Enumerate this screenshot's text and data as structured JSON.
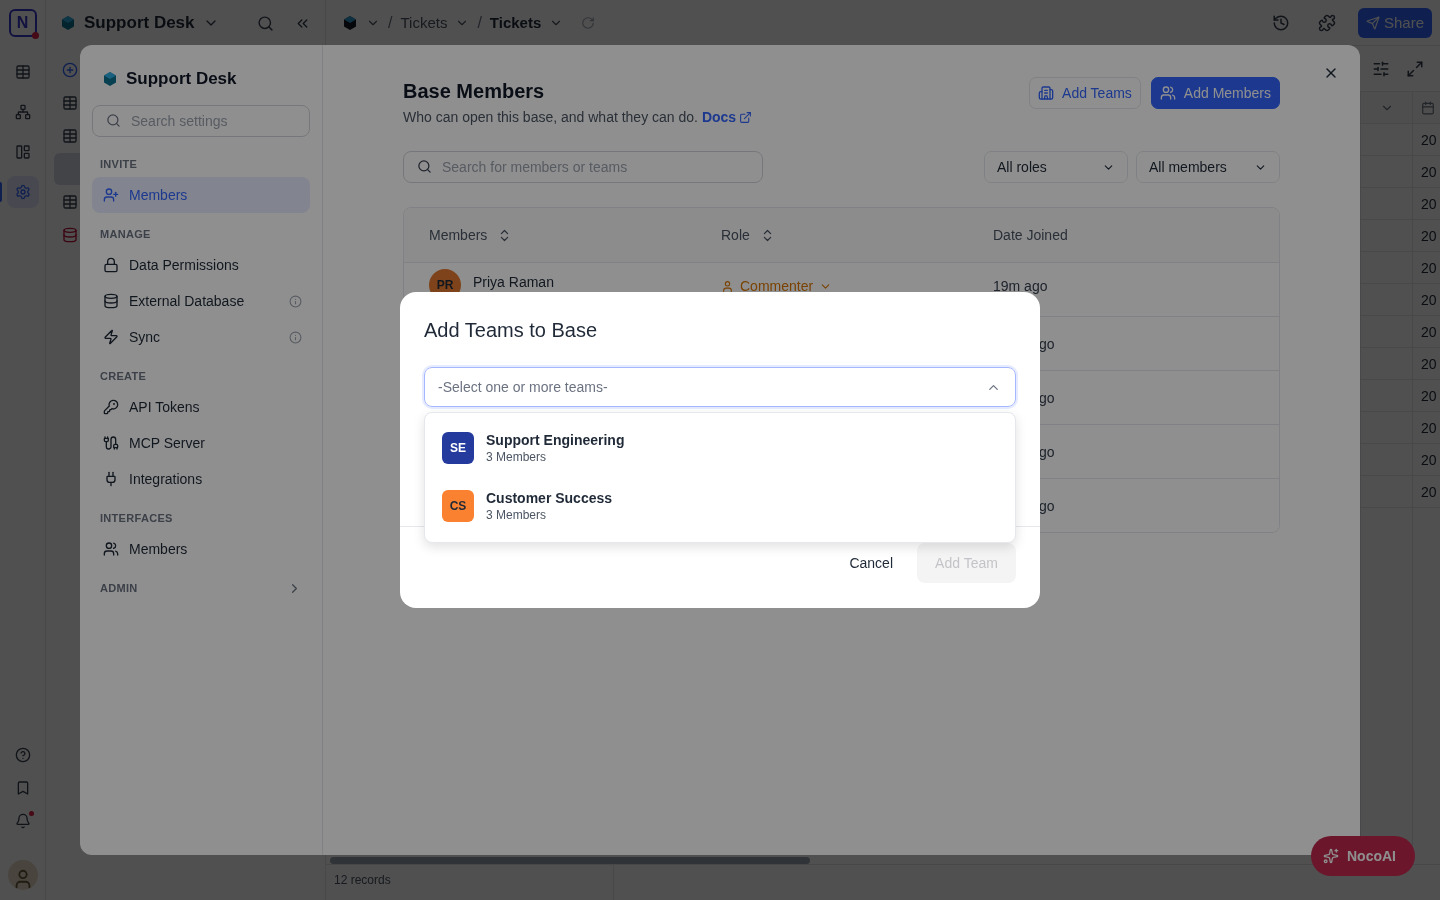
{
  "rail": {
    "logo": "N",
    "items": [
      {
        "selected": false
      },
      {
        "selected": false
      },
      {
        "selected": false
      },
      {
        "selected": true
      }
    ],
    "unread": true
  },
  "sidebar": {
    "title": "Support Desk",
    "rows": [
      {
        "kind": "add",
        "selected": false
      },
      {
        "kind": "table",
        "selected": false
      },
      {
        "kind": "table",
        "selected": false
      },
      {
        "kind": "blank",
        "selected": true
      },
      {
        "kind": "table",
        "selected": false
      },
      {
        "kind": "database",
        "selected": false
      }
    ]
  },
  "topbar": {
    "breadcrumb": [
      {
        "separator": "/",
        "label": "Tickets"
      },
      {
        "separator": "/",
        "label": "Tickets"
      }
    ],
    "share": "Share"
  },
  "grid": {
    "cells": [
      "20",
      "20",
      "20",
      "20",
      "20",
      "20",
      "20",
      "20",
      "20",
      "20",
      "20",
      "20"
    ]
  },
  "footer": {
    "records": "12 records"
  },
  "settings": {
    "title": "Support Desk",
    "search_placeholder": "Search settings",
    "sections": [
      {
        "heading": "INVITE",
        "items": [
          {
            "label": "Members",
            "selected": true,
            "info": false
          }
        ]
      },
      {
        "heading": "MANAGE",
        "items": [
          {
            "label": "Data Permissions",
            "selected": false,
            "info": false
          },
          {
            "label": "External Database",
            "selected": false,
            "info": true
          },
          {
            "label": "Sync",
            "selected": false,
            "info": true
          }
        ]
      },
      {
        "heading": "CREATE",
        "items": [
          {
            "label": "API Tokens",
            "selected": false,
            "info": false
          },
          {
            "label": "MCP Server",
            "selected": false,
            "info": false
          },
          {
            "label": "Integrations",
            "selected": false,
            "info": false
          }
        ]
      },
      {
        "heading": "INTERFACES",
        "items": [
          {
            "label": "Members",
            "selected": false,
            "info": false
          }
        ]
      },
      {
        "heading": "ADMIN",
        "expanded": false
      }
    ]
  },
  "members_page": {
    "title": "Base Members",
    "subtitle": "Who can open this base, and what they can do.",
    "docs_link": "Docs",
    "add_teams": "Add Teams",
    "add_members": "Add Members",
    "search_placeholder": "Search for members or teams",
    "filters": [
      "All roles",
      "All members"
    ],
    "columns": [
      "Members",
      "Role",
      "Date Joined"
    ],
    "rows": [
      {
        "kind": "member",
        "initials": "PR",
        "name": "Priya Raman",
        "role": "Commenter",
        "date": "19m ago"
      },
      {
        "kind": "covered",
        "date": "go"
      },
      {
        "kind": "covered",
        "date": "go"
      },
      {
        "kind": "covered",
        "date": "go"
      },
      {
        "kind": "covered",
        "date": "go"
      }
    ]
  },
  "dialog": {
    "title": "Add Teams to Base",
    "placeholder": "-Select one or more teams-",
    "expanded": true,
    "options": [
      {
        "initials": "SE",
        "name": "Support Engineering",
        "count": "3 Members",
        "color": "#243a9c"
      },
      {
        "initials": "CS",
        "name": "Customer Success",
        "count": "3 Members",
        "color": "#fa812f"
      }
    ],
    "cancel": "Cancel",
    "confirm": "Add Team",
    "confirm_disabled": true
  },
  "ai_button": "NocoAI"
}
